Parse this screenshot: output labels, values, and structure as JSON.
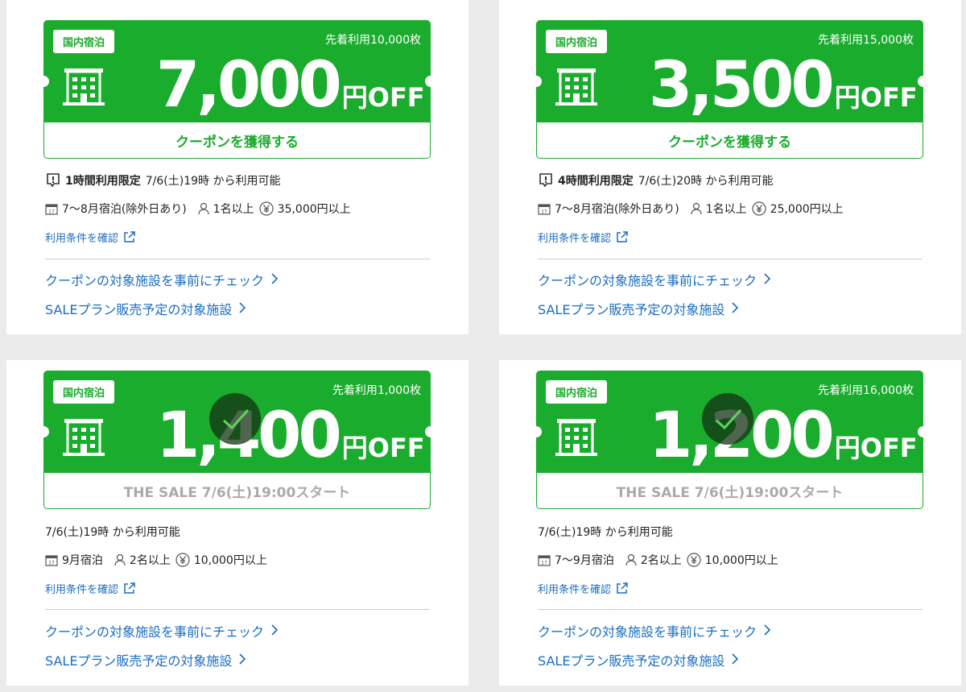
{
  "cards": [
    {
      "tag": "国内宿泊",
      "limit": "先着利用10,000枚",
      "amount": "7,000",
      "unit": "円OFF",
      "bottom": "クーポンを獲得する",
      "bold_prefix": "1時間利用限定",
      "available": "7/6(土)19時 から利用可能",
      "stay": "7〜8月宿泊(除外日あり)",
      "people": "1名以上",
      "price": "35,000円以上",
      "terms_link": "利用条件を確認",
      "link1": "クーポンの対象施設を事前にチェック",
      "link2": "SALEプラン販売予定の対象施設"
    },
    {
      "tag": "国内宿泊",
      "limit": "先着利用15,000枚",
      "amount": "3,500",
      "unit": "円OFF",
      "bottom": "クーポンを獲得する",
      "bold_prefix": "4時間利用限定",
      "available": "7/6(土)20時 から利用可能",
      "stay": "7〜8月宿泊(除外日あり)",
      "people": "1名以上",
      "price": "25,000円以上",
      "terms_link": "利用条件を確認",
      "link1": "クーポンの対象施設を事前にチェック",
      "link2": "SALEプラン販売予定の対象施設"
    },
    {
      "tag": "国内宿泊",
      "limit": "先着利用1,000枚",
      "amount": "1,400",
      "unit": "円OFF",
      "bottom": "THE SALE 7/6(土)19:00スタート",
      "available": "7/6(土)19時 から利用可能",
      "stay": "9月宿泊",
      "people": "2名以上",
      "price": "10,000円以上",
      "terms_link": "利用条件を確認",
      "link1": "クーポンの対象施設を事前にチェック",
      "link2": "SALEプラン販売予定の対象施設"
    },
    {
      "tag": "国内宿泊",
      "limit": "先着利用16,000枚",
      "amount": "1,200",
      "unit": "円OFF",
      "bottom": "THE SALE 7/6(土)19:00スタート",
      "available": "7/6(土)19時 から利用可能",
      "stay": "7〜9月宿泊",
      "people": "2名以上",
      "price": "10,000円以上",
      "terms_link": "利用条件を確認",
      "link1": "クーポンの対象施設を事前にチェック",
      "link2": "SALEプラン販売予定の対象施設"
    }
  ],
  "icons": {
    "building": "building-icon",
    "alert": "alert-icon",
    "calendar": "calendar-icon",
    "person": "person-icon",
    "yen": "yen-icon",
    "external": "external-link-icon",
    "chevron": "chevron-right-icon",
    "check": "check-icon"
  },
  "colors": {
    "brand_green": "#1aac2c",
    "link_blue": "#1a6dc0"
  }
}
